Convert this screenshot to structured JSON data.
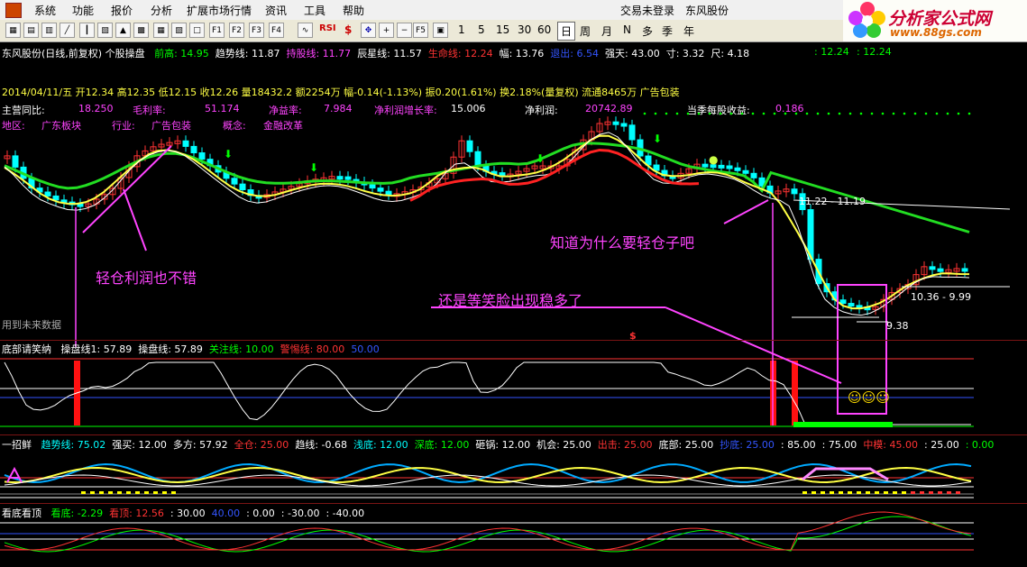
{
  "menu": {
    "items": [
      "系统",
      "功能",
      "报价",
      "分析",
      "扩展市场行情",
      "资讯",
      "工具",
      "帮助"
    ],
    "login": "交易未登录",
    "stock": "东风股份"
  },
  "toolbar": {
    "periods": [
      "1",
      "5",
      "15",
      "30",
      "60",
      "日",
      "周",
      "月",
      "N",
      "多",
      "季",
      "年"
    ],
    "rsi": "RSI"
  },
  "logo": {
    "title": "分析家公式网",
    "url": "www.88gs.com"
  },
  "header": {
    "title": "东风股份(日线,前复权) 个股操盘",
    "items": [
      {
        "label": "前高: 14.95",
        "color": "#00ff00"
      },
      {
        "label": "趋势线: 11.87",
        "color": "#ffffff"
      },
      {
        "label": "持股线: 11.77",
        "color": "#ff44ff"
      },
      {
        "label": "辰星线: 11.57",
        "color": "#ffffff"
      },
      {
        "label": "生命线: 12.24",
        "color": "#ff3333"
      },
      {
        "label": "幅: 13.76",
        "color": "#ffffff"
      },
      {
        "label": "退出: 6.54",
        "color": "#3355ff"
      },
      {
        "label": "强天: 43.00",
        "color": "#ffffff"
      },
      {
        "label": "寸: 3.32",
        "color": "#ffffff"
      },
      {
        "label": "尺: 4.18",
        "color": "#ffffff"
      }
    ],
    "right_vals": [
      ": 12.24",
      ": 12.24"
    ]
  },
  "quote": {
    "date": "2014/04/11/五",
    "open": "开12.34",
    "high": "高12.35",
    "low": "低12.15",
    "close": "收12.26",
    "vol": "量18432.2",
    "amount": "额2254万",
    "change": "幅-0.14(-1.13%)",
    "amp": "振0.20(1.61%)",
    "turnover": "换2.18%(量复权)",
    "float": "流通8465万",
    "industry": "广告包装"
  },
  "fundamentals": {
    "row1": [
      {
        "k": "主营同比:",
        "v": "18.250"
      },
      {
        "k": "毛利率:",
        "v": "51.174"
      },
      {
        "k": "净益率:",
        "v": "7.984"
      },
      {
        "k": "净利润增长率:",
        "v": "15.006"
      },
      {
        "k": "净利润:",
        "v": "20742.89"
      },
      {
        "k": "当季每股收益:",
        "v": "0.186"
      }
    ],
    "row2": [
      {
        "k": "地区:",
        "v": "广东板块"
      },
      {
        "k": "行业:",
        "v": "广告包装"
      },
      {
        "k": "概念:",
        "v": "金融改革"
      }
    ]
  },
  "annotations": {
    "a1": "轻仓利润也不错",
    "a2": "还是等笑脸出现稳多了",
    "a3": "知道为什么要轻仓子吧",
    "future": "用到未来数据",
    "price_high": "11.22 - 11.19",
    "price_mid": "10.36 - 9.99",
    "price_low": "9.38",
    "dollar": "$"
  },
  "panel1": {
    "title": "底部请笑纳",
    "items": [
      {
        "label": "操盘线1: 57.89",
        "color": "#ffffff"
      },
      {
        "label": "操盘线: 57.89",
        "color": "#ffffff"
      },
      {
        "label": "关注线: 10.00",
        "color": "#00ff00"
      },
      {
        "label": "警惕线: 80.00",
        "color": "#ff3333"
      },
      {
        "label": "50.00",
        "color": "#3355ff"
      }
    ]
  },
  "panel2": {
    "title": "一招鲜",
    "items": [
      {
        "label": "趋势线: 75.02",
        "color": "#00ffff"
      },
      {
        "label": "强买: 12.00",
        "color": "#ffffff"
      },
      {
        "label": "多方: 57.92",
        "color": "#ffffff"
      },
      {
        "label": "全仓: 25.00",
        "color": "#ff3333"
      },
      {
        "label": "趋线: -0.68",
        "color": "#ffffff"
      },
      {
        "label": "浅底: 12.00",
        "color": "#00ffff"
      },
      {
        "label": "深底: 12.00",
        "color": "#00ff00"
      },
      {
        "label": "砸锅: 12.00",
        "color": "#ffffff"
      },
      {
        "label": "机会: 25.00",
        "color": "#ffffff"
      },
      {
        "label": "出击: 25.00",
        "color": "#ff3333"
      },
      {
        "label": "底部: 25.00",
        "color": "#ffffff"
      },
      {
        "label": "抄底: 25.00",
        "color": "#3355ff"
      },
      {
        "label": ": 85.00",
        "color": "#ffffff"
      },
      {
        "label": ": 75.00",
        "color": "#ffffff"
      },
      {
        "label": "中模: 45.00",
        "color": "#ff3333"
      },
      {
        "label": ": 25.00",
        "color": "#ffffff"
      },
      {
        "label": ": 0.00",
        "color": "#00ff00"
      }
    ]
  },
  "panel3": {
    "title": "看底看顶",
    "items": [
      {
        "label": "看底: -2.29",
        "color": "#00ff00"
      },
      {
        "label": "看顶: 12.56",
        "color": "#ff3333"
      },
      {
        "label": ": 30.00",
        "color": "#ffffff"
      },
      {
        "label": "40.00",
        "color": "#3355ff"
      },
      {
        "label": ": 0.00",
        "color": "#ffffff"
      },
      {
        "label": ": -30.00",
        "color": "#ffffff"
      },
      {
        "label": ": -40.00",
        "color": "#ffffff"
      }
    ]
  },
  "colors": {
    "up": "#ff3333",
    "down": "#00ffff",
    "ma_green": "#22dd22",
    "ma_yellow": "#ffff44",
    "ma_white": "#ffffff",
    "ma_red": "#ff2222",
    "annotation": "#ff44ff"
  }
}
